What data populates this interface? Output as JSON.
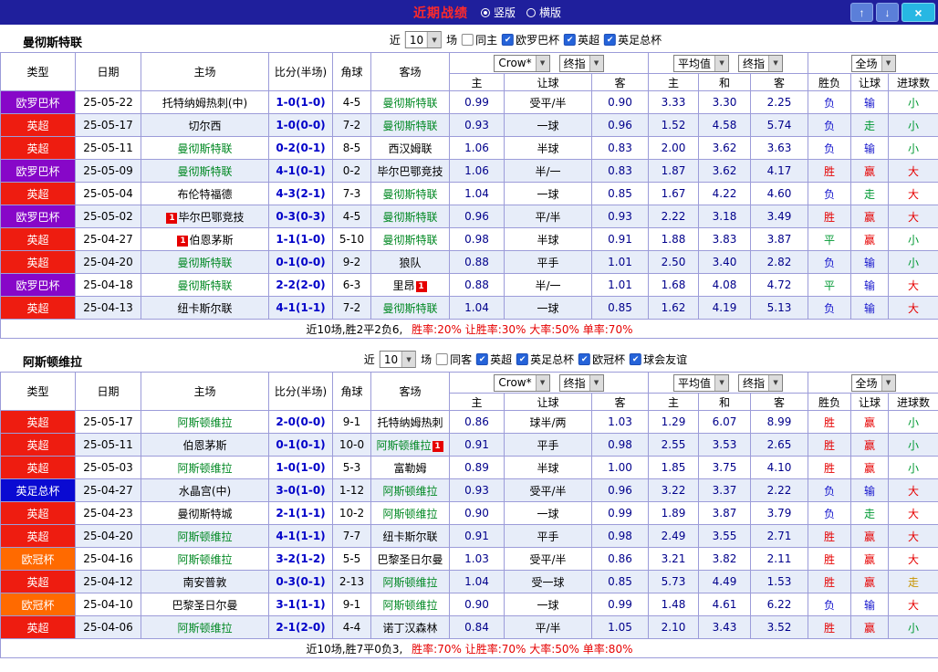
{
  "titlebar": {
    "title": "近期战绩",
    "radios": [
      {
        "label": "竖版",
        "selected": true
      },
      {
        "label": "横版",
        "selected": false
      }
    ]
  },
  "icons": {
    "up_arrow": "↑",
    "down_arrow": "↓",
    "close": "×",
    "chevron_down": "▼",
    "check": "✔"
  },
  "header_dropdowns": {
    "odds1_source": "Crow*",
    "odds1_time": "终指",
    "odds2_source": "平均值",
    "odds2_time": "终指",
    "result_scope": "全场"
  },
  "columns": {
    "type": "类型",
    "date": "日期",
    "home": "主场",
    "score": "比分(半场)",
    "corner": "角球",
    "away": "客场",
    "sub": [
      "主",
      "让球",
      "客",
      "主",
      "和",
      "客",
      "胜负",
      "让球",
      "进球数"
    ]
  },
  "colors": {
    "league": {
      "red": "#ee1c10",
      "purple": "#8707c8",
      "blue": "#0a0ad2",
      "orange": "#ff6a00"
    },
    "result": {
      "r": "#e60000",
      "g": "#009933",
      "b": "#1414cc",
      "y": "#c89400"
    },
    "focus_team": "#008822",
    "badge": "#e60000",
    "odds_text": "#00008b",
    "score_text": "#0000c8",
    "titlebar_bg": "#1f1f9c",
    "title_text": "#ff2a2a",
    "stripe": "#e7edf9",
    "grid": "#9c9cd9",
    "checkbox": "#2563d9",
    "close_button": "#27b7e3",
    "arrow_buttons": "#5b7fd9"
  },
  "sections": [
    {
      "team": "曼彻斯特联",
      "filter": {
        "prefix": "近",
        "count": "10",
        "suffix": "场",
        "checks": [
          {
            "label": "同主",
            "checked": false
          },
          {
            "label": "欧罗巴杯",
            "checked": true
          },
          {
            "label": "英超",
            "checked": true
          },
          {
            "label": "英足总杯",
            "checked": true
          }
        ]
      },
      "rows": [
        {
          "type": "欧罗巴杯",
          "tc": "purple",
          "date": "25-05-22",
          "home": {
            "n": "托特纳姆热刺(中)",
            "f": false
          },
          "score": "1-0(1-0)",
          "corner": "4-5",
          "away": {
            "n": "曼彻斯特联",
            "f": true
          },
          "o": [
            "0.99",
            "受平/半",
            "0.90"
          ],
          "avg": [
            "3.33",
            "3.30",
            "2.25"
          ],
          "res": [
            [
              "负",
              "b"
            ],
            [
              "输",
              "b"
            ],
            [
              "小",
              "g"
            ]
          ]
        },
        {
          "type": "英超",
          "tc": "red",
          "date": "25-05-17",
          "home": {
            "n": "切尔西",
            "f": false
          },
          "score": "1-0(0-0)",
          "corner": "7-2",
          "away": {
            "n": "曼彻斯特联",
            "f": true
          },
          "o": [
            "0.93",
            "一球",
            "0.96"
          ],
          "avg": [
            "1.52",
            "4.58",
            "5.74"
          ],
          "res": [
            [
              "负",
              "b"
            ],
            [
              "走",
              "g"
            ],
            [
              "小",
              "g"
            ]
          ]
        },
        {
          "type": "英超",
          "tc": "red",
          "date": "25-05-11",
          "home": {
            "n": "曼彻斯特联",
            "f": true
          },
          "score": "0-2(0-1)",
          "corner": "8-5",
          "away": {
            "n": "西汉姆联",
            "f": false
          },
          "o": [
            "1.06",
            "半球",
            "0.83"
          ],
          "avg": [
            "2.00",
            "3.62",
            "3.63"
          ],
          "res": [
            [
              "负",
              "b"
            ],
            [
              "输",
              "b"
            ],
            [
              "小",
              "g"
            ]
          ]
        },
        {
          "type": "欧罗巴杯",
          "tc": "purple",
          "date": "25-05-09",
          "home": {
            "n": "曼彻斯特联",
            "f": true
          },
          "score": "4-1(0-1)",
          "corner": "0-2",
          "away": {
            "n": "毕尔巴鄂竞技",
            "f": false
          },
          "o": [
            "1.06",
            "半/一",
            "0.83"
          ],
          "avg": [
            "1.87",
            "3.62",
            "4.17"
          ],
          "res": [
            [
              "胜",
              "r"
            ],
            [
              "赢",
              "r"
            ],
            [
              "大",
              "r"
            ]
          ]
        },
        {
          "type": "英超",
          "tc": "red",
          "date": "25-05-04",
          "home": {
            "n": "布伦特福德",
            "f": false
          },
          "score": "4-3(2-1)",
          "corner": "7-3",
          "away": {
            "n": "曼彻斯特联",
            "f": true
          },
          "o": [
            "1.04",
            "一球",
            "0.85"
          ],
          "avg": [
            "1.67",
            "4.22",
            "4.60"
          ],
          "res": [
            [
              "负",
              "b"
            ],
            [
              "走",
              "g"
            ],
            [
              "大",
              "r"
            ]
          ]
        },
        {
          "type": "欧罗巴杯",
          "tc": "purple",
          "date": "25-05-02",
          "home": {
            "n": "毕尔巴鄂竞技",
            "f": false,
            "b1": "1"
          },
          "score": "0-3(0-3)",
          "corner": "4-5",
          "away": {
            "n": "曼彻斯特联",
            "f": true
          },
          "o": [
            "0.96",
            "平/半",
            "0.93"
          ],
          "avg": [
            "2.22",
            "3.18",
            "3.49"
          ],
          "res": [
            [
              "胜",
              "r"
            ],
            [
              "赢",
              "r"
            ],
            [
              "大",
              "r"
            ]
          ]
        },
        {
          "type": "英超",
          "tc": "red",
          "date": "25-04-27",
          "home": {
            "n": "伯恩茅斯",
            "f": false,
            "b1": "1"
          },
          "score": "1-1(1-0)",
          "corner": "5-10",
          "away": {
            "n": "曼彻斯特联",
            "f": true
          },
          "o": [
            "0.98",
            "半球",
            "0.91"
          ],
          "avg": [
            "1.88",
            "3.83",
            "3.87"
          ],
          "res": [
            [
              "平",
              "g"
            ],
            [
              "赢",
              "r"
            ],
            [
              "小",
              "g"
            ]
          ]
        },
        {
          "type": "英超",
          "tc": "red",
          "date": "25-04-20",
          "home": {
            "n": "曼彻斯特联",
            "f": true
          },
          "score": "0-1(0-0)",
          "corner": "9-2",
          "away": {
            "n": "狼队",
            "f": false
          },
          "o": [
            "0.88",
            "平手",
            "1.01"
          ],
          "avg": [
            "2.50",
            "3.40",
            "2.82"
          ],
          "res": [
            [
              "负",
              "b"
            ],
            [
              "输",
              "b"
            ],
            [
              "小",
              "g"
            ]
          ]
        },
        {
          "type": "欧罗巴杯",
          "tc": "purple",
          "date": "25-04-18",
          "home": {
            "n": "曼彻斯特联",
            "f": true
          },
          "score": "2-2(2-0)",
          "corner": "6-3",
          "away": {
            "n": "里昂",
            "f": false,
            "b2": "1"
          },
          "o": [
            "0.88",
            "半/一",
            "1.01"
          ],
          "avg": [
            "1.68",
            "4.08",
            "4.72"
          ],
          "res": [
            [
              "平",
              "g"
            ],
            [
              "输",
              "b"
            ],
            [
              "大",
              "r"
            ]
          ]
        },
        {
          "type": "英超",
          "tc": "red",
          "date": "25-04-13",
          "home": {
            "n": "纽卡斯尔联",
            "f": false
          },
          "score": "4-1(1-1)",
          "corner": "7-2",
          "away": {
            "n": "曼彻斯特联",
            "f": true
          },
          "o": [
            "1.04",
            "一球",
            "0.85"
          ],
          "avg": [
            "1.62",
            "4.19",
            "5.13"
          ],
          "res": [
            [
              "负",
              "b"
            ],
            [
              "输",
              "b"
            ],
            [
              "大",
              "r"
            ]
          ]
        }
      ],
      "footer": {
        "summary": "近10场,胜2平2负6,",
        "rates": "胜率:20% 让胜率:30% 大率:50% 单率:70%"
      }
    },
    {
      "team": "阿斯顿维拉",
      "filter": {
        "prefix": "近",
        "count": "10",
        "suffix": "场",
        "checks": [
          {
            "label": "同客",
            "checked": false
          },
          {
            "label": "英超",
            "checked": true
          },
          {
            "label": "英足总杯",
            "checked": true
          },
          {
            "label": "欧冠杯",
            "checked": true
          },
          {
            "label": "球会友谊",
            "checked": true
          }
        ]
      },
      "rows": [
        {
          "type": "英超",
          "tc": "red",
          "date": "25-05-17",
          "home": {
            "n": "阿斯顿维拉",
            "f": true
          },
          "score": "2-0(0-0)",
          "corner": "9-1",
          "away": {
            "n": "托特纳姆热刺",
            "f": false
          },
          "o": [
            "0.86",
            "球半/两",
            "1.03"
          ],
          "avg": [
            "1.29",
            "6.07",
            "8.99"
          ],
          "res": [
            [
              "胜",
              "r"
            ],
            [
              "赢",
              "r"
            ],
            [
              "小",
              "g"
            ]
          ]
        },
        {
          "type": "英超",
          "tc": "red",
          "date": "25-05-11",
          "home": {
            "n": "伯恩茅斯",
            "f": false
          },
          "score": "0-1(0-1)",
          "corner": "10-0",
          "away": {
            "n": "阿斯顿维拉",
            "f": true,
            "b2": "1"
          },
          "o": [
            "0.91",
            "平手",
            "0.98"
          ],
          "avg": [
            "2.55",
            "3.53",
            "2.65"
          ],
          "res": [
            [
              "胜",
              "r"
            ],
            [
              "赢",
              "r"
            ],
            [
              "小",
              "g"
            ]
          ]
        },
        {
          "type": "英超",
          "tc": "red",
          "date": "25-05-03",
          "home": {
            "n": "阿斯顿维拉",
            "f": true
          },
          "score": "1-0(1-0)",
          "corner": "5-3",
          "away": {
            "n": "富勒姆",
            "f": false
          },
          "o": [
            "0.89",
            "半球",
            "1.00"
          ],
          "avg": [
            "1.85",
            "3.75",
            "4.10"
          ],
          "res": [
            [
              "胜",
              "r"
            ],
            [
              "赢",
              "r"
            ],
            [
              "小",
              "g"
            ]
          ]
        },
        {
          "type": "英足总杯",
          "tc": "blue",
          "date": "25-04-27",
          "home": {
            "n": "水晶宫(中)",
            "f": false
          },
          "score": "3-0(1-0)",
          "corner": "1-12",
          "away": {
            "n": "阿斯顿维拉",
            "f": true
          },
          "o": [
            "0.93",
            "受平/半",
            "0.96"
          ],
          "avg": [
            "3.22",
            "3.37",
            "2.22"
          ],
          "res": [
            [
              "负",
              "b"
            ],
            [
              "输",
              "b"
            ],
            [
              "大",
              "r"
            ]
          ]
        },
        {
          "type": "英超",
          "tc": "red",
          "date": "25-04-23",
          "home": {
            "n": "曼彻斯特城",
            "f": false
          },
          "score": "2-1(1-1)",
          "corner": "10-2",
          "away": {
            "n": "阿斯顿维拉",
            "f": true
          },
          "o": [
            "0.90",
            "一球",
            "0.99"
          ],
          "avg": [
            "1.89",
            "3.87",
            "3.79"
          ],
          "res": [
            [
              "负",
              "b"
            ],
            [
              "走",
              "g"
            ],
            [
              "大",
              "r"
            ]
          ]
        },
        {
          "type": "英超",
          "tc": "red",
          "date": "25-04-20",
          "home": {
            "n": "阿斯顿维拉",
            "f": true
          },
          "score": "4-1(1-1)",
          "corner": "7-7",
          "away": {
            "n": "纽卡斯尔联",
            "f": false
          },
          "o": [
            "0.91",
            "平手",
            "0.98"
          ],
          "avg": [
            "2.49",
            "3.55",
            "2.71"
          ],
          "res": [
            [
              "胜",
              "r"
            ],
            [
              "赢",
              "r"
            ],
            [
              "大",
              "r"
            ]
          ]
        },
        {
          "type": "欧冠杯",
          "tc": "orange",
          "date": "25-04-16",
          "home": {
            "n": "阿斯顿维拉",
            "f": true
          },
          "score": "3-2(1-2)",
          "corner": "5-5",
          "away": {
            "n": "巴黎圣日尔曼",
            "f": false
          },
          "o": [
            "1.03",
            "受平/半",
            "0.86"
          ],
          "avg": [
            "3.21",
            "3.82",
            "2.11"
          ],
          "res": [
            [
              "胜",
              "r"
            ],
            [
              "赢",
              "r"
            ],
            [
              "大",
              "r"
            ]
          ]
        },
        {
          "type": "英超",
          "tc": "red",
          "date": "25-04-12",
          "home": {
            "n": "南安普敦",
            "f": false
          },
          "score": "0-3(0-1)",
          "corner": "2-13",
          "away": {
            "n": "阿斯顿维拉",
            "f": true
          },
          "o": [
            "1.04",
            "受一球",
            "0.85"
          ],
          "avg": [
            "5.73",
            "4.49",
            "1.53"
          ],
          "res": [
            [
              "胜",
              "r"
            ],
            [
              "赢",
              "r"
            ],
            [
              "走",
              "y"
            ]
          ]
        },
        {
          "type": "欧冠杯",
          "tc": "orange",
          "date": "25-04-10",
          "home": {
            "n": "巴黎圣日尔曼",
            "f": false
          },
          "score": "3-1(1-1)",
          "corner": "9-1",
          "away": {
            "n": "阿斯顿维拉",
            "f": true
          },
          "o": [
            "0.90",
            "一球",
            "0.99"
          ],
          "avg": [
            "1.48",
            "4.61",
            "6.22"
          ],
          "res": [
            [
              "负",
              "b"
            ],
            [
              "输",
              "b"
            ],
            [
              "大",
              "r"
            ]
          ]
        },
        {
          "type": "英超",
          "tc": "red",
          "date": "25-04-06",
          "home": {
            "n": "阿斯顿维拉",
            "f": true
          },
          "score": "2-1(2-0)",
          "corner": "4-4",
          "away": {
            "n": "诺丁汉森林",
            "f": false
          },
          "o": [
            "0.84",
            "平/半",
            "1.05"
          ],
          "avg": [
            "2.10",
            "3.43",
            "3.52"
          ],
          "res": [
            [
              "胜",
              "r"
            ],
            [
              "赢",
              "r"
            ],
            [
              "小",
              "g"
            ]
          ]
        }
      ],
      "footer": {
        "summary": "近10场,胜7平0负3,",
        "rates": "胜率:70% 让胜率:70% 大率:50% 单率:80%"
      }
    }
  ]
}
